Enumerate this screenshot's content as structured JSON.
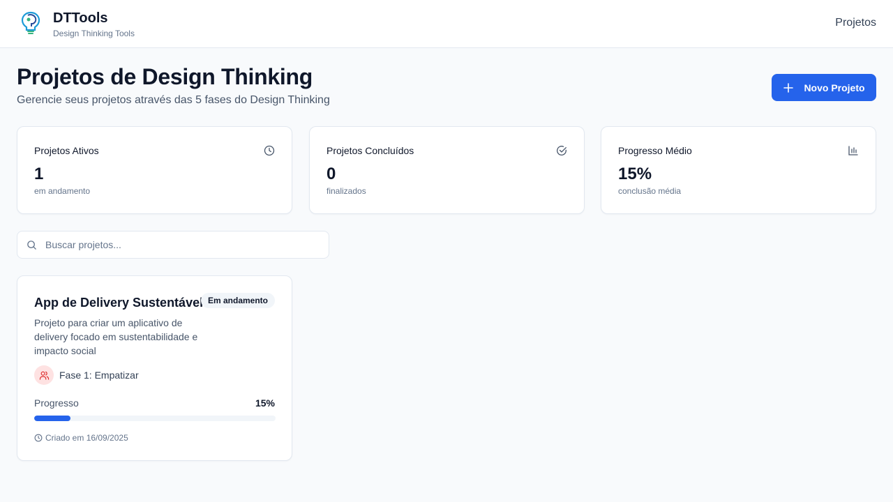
{
  "header": {
    "brand_name": "DTTools",
    "brand_tagline": "Design Thinking Tools",
    "nav_projects": "Projetos"
  },
  "page": {
    "title": "Projetos de Design Thinking",
    "subtitle": "Gerencie seus projetos através das 5 fases do Design Thinking",
    "new_project_label": "Novo Projeto"
  },
  "stats": [
    {
      "label": "Projetos Ativos",
      "value": "1",
      "caption": "em andamento",
      "icon": "clock-icon"
    },
    {
      "label": "Projetos Concluídos",
      "value": "0",
      "caption": "finalizados",
      "icon": "check-circle-icon"
    },
    {
      "label": "Progresso Médio",
      "value": "15%",
      "caption": "conclusão média",
      "icon": "bar-chart-icon"
    }
  ],
  "search": {
    "placeholder": "Buscar projetos...",
    "value": ""
  },
  "projects": [
    {
      "title": "App de Delivery Sustentável",
      "status": "Em andamento",
      "description": "Projeto para criar um aplicativo de delivery focado em sustentabilidade e impacto social",
      "phase": "Fase 1: Empatizar",
      "phase_icon": "users-icon",
      "progress_label": "Progresso",
      "progress_text": "15%",
      "progress": 0.15,
      "created": "Criado em 16/09/2025"
    }
  ],
  "colors": {
    "primary": "#2563eb",
    "phase_bg": "#fee2e2",
    "phase_icon": "#dc2626",
    "badge_bg": "#f1f5f9"
  }
}
